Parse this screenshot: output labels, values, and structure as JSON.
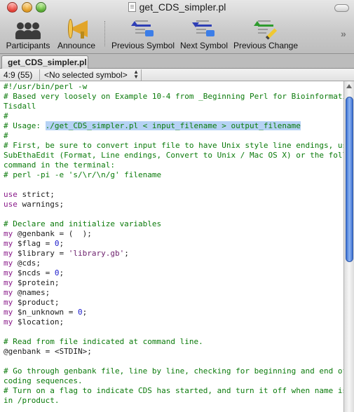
{
  "window": {
    "title": "get_CDS_simpler.pl"
  },
  "toolbar": {
    "participants_label": "Participants",
    "announce_label": "Announce",
    "previous_symbol_label": "Previous Symbol",
    "next_symbol_label": "Next Symbol",
    "previous_change_label": "Previous Change",
    "overflow_glyph": "»"
  },
  "tab": {
    "label": "get_CDS_simpler.pl"
  },
  "status": {
    "cursor": "4:9 (55)",
    "symbol_menu": "<No selected symbol>"
  },
  "code_lines": [
    [
      {
        "t": "#!/usr/bin/perl -w",
        "c": "comment"
      }
    ],
    [
      {
        "t": "# Based very loosely on Example 10-4 from _Beginning Perl for Bioinformatics_ by",
        "c": "comment"
      }
    ],
    [
      {
        "t": "Tisdall",
        "c": "comment"
      }
    ],
    [
      {
        "t": "#",
        "c": "comment"
      }
    ],
    [
      {
        "t": "# Usage: ",
        "c": "comment"
      },
      {
        "t": "./get_CDS_simpler.pl < input_filename > output_filename",
        "c": "sel"
      }
    ],
    [
      {
        "t": "#",
        "c": "comment"
      }
    ],
    [
      {
        "t": "# First, be sure to convert input file to have Unix style line endings, using",
        "c": "comment"
      }
    ],
    [
      {
        "t": "SubEthaEdit (Format, Line endings, Convert to Unix / Mac OS X) or the following",
        "c": "comment"
      }
    ],
    [
      {
        "t": "command in the terminal:",
        "c": "comment"
      }
    ],
    [
      {
        "t": "# perl -pi -e 's/\\r/\\n/g' filename",
        "c": "comment"
      }
    ],
    [],
    [
      {
        "t": "use",
        "c": "keyword"
      },
      {
        "t": " strict;",
        "c": "plain"
      }
    ],
    [
      {
        "t": "use",
        "c": "keyword"
      },
      {
        "t": " warnings;",
        "c": "plain"
      }
    ],
    [],
    [
      {
        "t": "# Declare and initialize variables",
        "c": "comment"
      }
    ],
    [
      {
        "t": "my",
        "c": "keyword"
      },
      {
        "t": " @genbank = (  );",
        "c": "plain"
      }
    ],
    [
      {
        "t": "my",
        "c": "keyword"
      },
      {
        "t": " $flag = ",
        "c": "plain"
      },
      {
        "t": "0",
        "c": "number"
      },
      {
        "t": ";",
        "c": "plain"
      }
    ],
    [
      {
        "t": "my",
        "c": "keyword"
      },
      {
        "t": " $library = ",
        "c": "plain"
      },
      {
        "t": "'library.gb'",
        "c": "string"
      },
      {
        "t": ";",
        "c": "plain"
      }
    ],
    [
      {
        "t": "my",
        "c": "keyword"
      },
      {
        "t": " @cds;",
        "c": "plain"
      }
    ],
    [
      {
        "t": "my",
        "c": "keyword"
      },
      {
        "t": " $ncds = ",
        "c": "plain"
      },
      {
        "t": "0",
        "c": "number"
      },
      {
        "t": ";",
        "c": "plain"
      }
    ],
    [
      {
        "t": "my",
        "c": "keyword"
      },
      {
        "t": " $protein;",
        "c": "plain"
      }
    ],
    [
      {
        "t": "my",
        "c": "keyword"
      },
      {
        "t": " @names;",
        "c": "plain"
      }
    ],
    [
      {
        "t": "my",
        "c": "keyword"
      },
      {
        "t": " $product;",
        "c": "plain"
      }
    ],
    [
      {
        "t": "my",
        "c": "keyword"
      },
      {
        "t": " $n_unknown = ",
        "c": "plain"
      },
      {
        "t": "0",
        "c": "number"
      },
      {
        "t": ";",
        "c": "plain"
      }
    ],
    [
      {
        "t": "my",
        "c": "keyword"
      },
      {
        "t": " $location;",
        "c": "plain"
      }
    ],
    [],
    [
      {
        "t": "# Read from file indicated at command line.",
        "c": "comment"
      }
    ],
    [
      {
        "t": "@genbank = <STDIN>;",
        "c": "plain"
      }
    ],
    [],
    [
      {
        "t": "# Go through genbank file, line by line, checking for beginning and end of",
        "c": "comment"
      }
    ],
    [
      {
        "t": "coding sequences.",
        "c": "comment"
      }
    ],
    [
      {
        "t": "# Turn on a flag to indicate CDS has started, and turn it off when name is found",
        "c": "comment"
      }
    ],
    [
      {
        "t": "in /product.",
        "c": "comment"
      }
    ]
  ]
}
